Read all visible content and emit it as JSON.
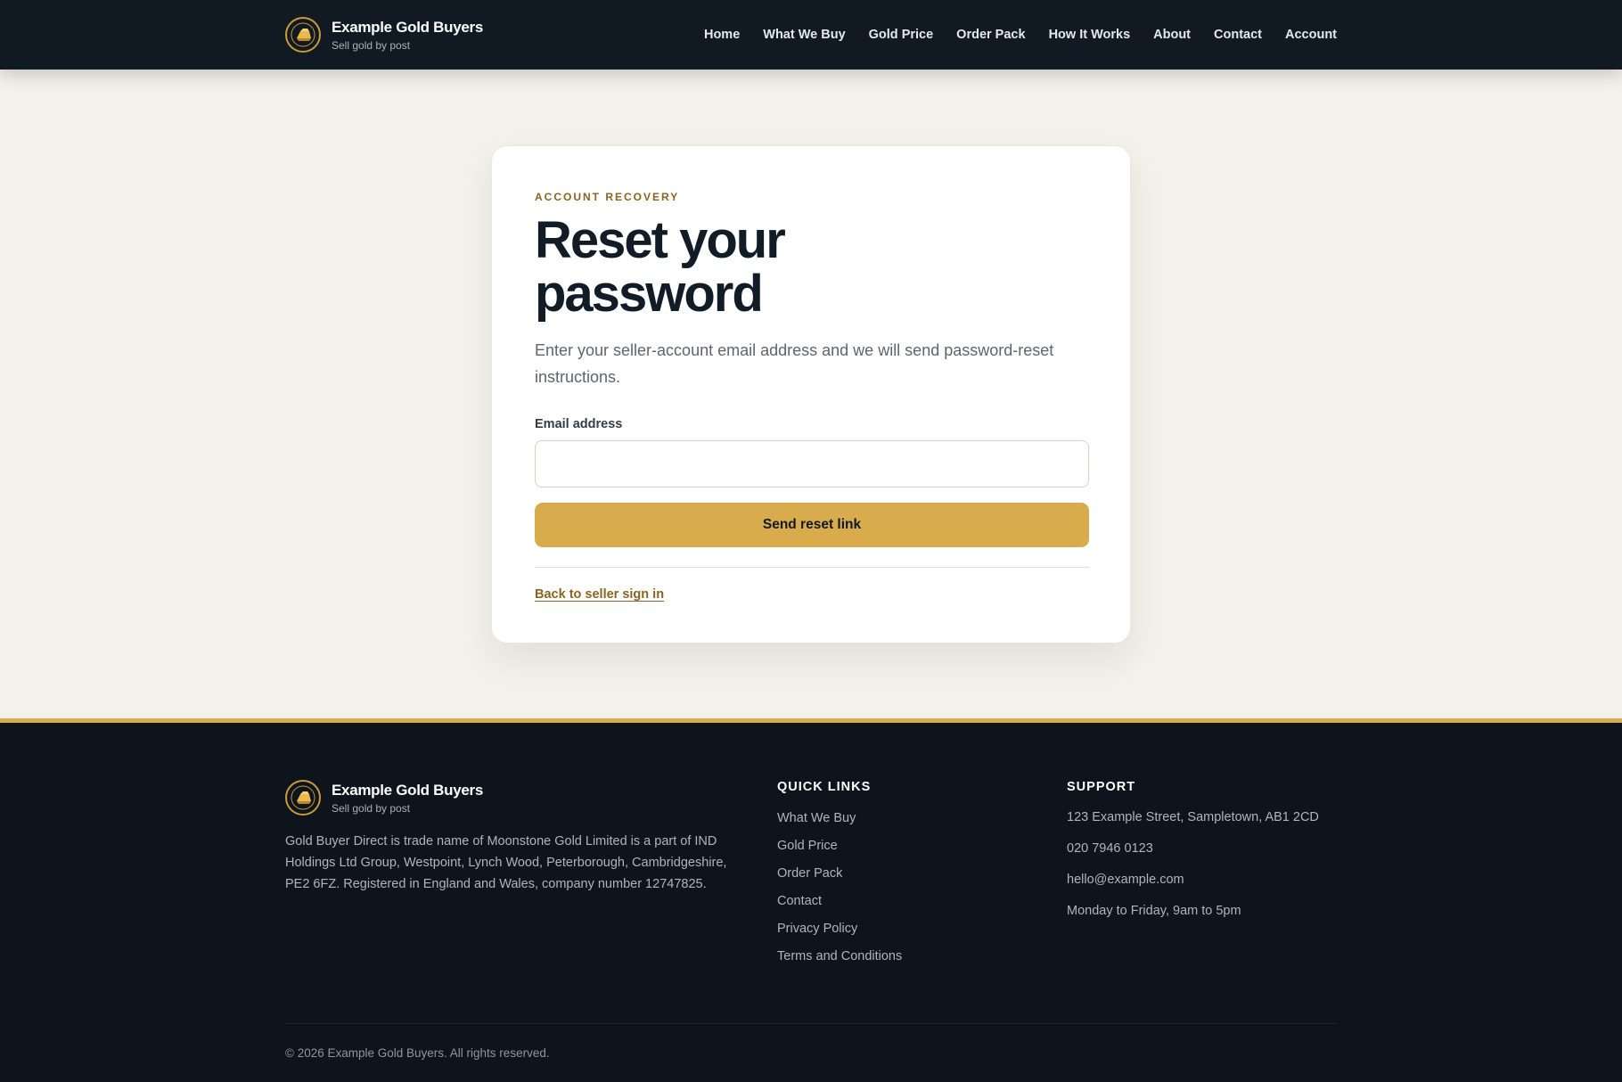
{
  "brand": {
    "name": "Example Gold Buyers",
    "tagline": "Sell gold by post"
  },
  "nav": [
    {
      "label": "Home"
    },
    {
      "label": "What We Buy"
    },
    {
      "label": "Gold Price"
    },
    {
      "label": "Order Pack"
    },
    {
      "label": "How It Works"
    },
    {
      "label": "About"
    },
    {
      "label": "Contact"
    },
    {
      "label": "Account"
    }
  ],
  "card": {
    "eyebrow": "ACCOUNT RECOVERY",
    "title": "Reset your password",
    "lead": "Enter your seller-account email address and we will send password-reset instructions.",
    "email_label": "Email address",
    "email_value": "",
    "email_placeholder": "",
    "submit_label": "Send reset link",
    "back_link": "Back to seller sign in"
  },
  "footer": {
    "about": "Gold Buyer Direct is trade name of Moonstone Gold Limited is a part of IND Holdings Ltd Group, Westpoint, Lynch Wood, Peterborough, Cambridgeshire, PE2 6FZ. Registered in England and Wales, company number 12747825.",
    "quick_links_title": "QUICK LINKS",
    "quick_links": [
      {
        "label": "What We Buy"
      },
      {
        "label": "Gold Price"
      },
      {
        "label": "Order Pack"
      },
      {
        "label": "Contact"
      },
      {
        "label": "Privacy Policy"
      },
      {
        "label": "Terms and Conditions"
      }
    ],
    "support_title": "SUPPORT",
    "support": {
      "address": "123 Example Street, Sampletown, AB1 2CD",
      "phone": "020 7946 0123",
      "email": "hello@example.com",
      "hours": "Monday to Friday, 9am to 5pm"
    },
    "copyright": "© 2026 Example Gold Buyers. All rights reserved."
  },
  "colors": {
    "header_bg": "#111a22",
    "page_bg": "#f4f1ea",
    "accent_gold": "#d8ab4c",
    "link_gold": "#8a6420",
    "footer_bg": "#0d141b"
  },
  "icons": {
    "logo": "gold-bar-logo-icon"
  }
}
